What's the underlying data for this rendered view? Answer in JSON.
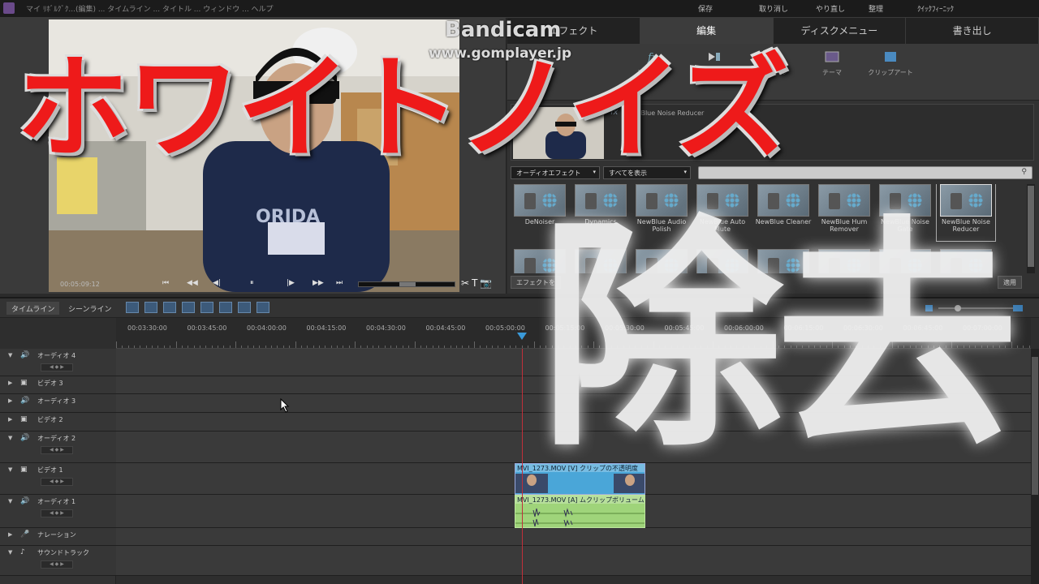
{
  "window": {
    "title": "マイ ﾘﾎﾞﾙｸﾞｸ...(編集) ... タイムライン ... タイトル ... ウィンドウ ... ヘルプ",
    "menu_right": [
      "保存",
      "取り消し",
      "やり直し",
      "整理",
      "ｸｲｯｸﾌｨｰﾆｯｸ"
    ]
  },
  "watermark": {
    "brand": "Bandicam",
    "url": "www.gomplayer.jp"
  },
  "overlay_text": {
    "red_caption": "ホワイトノイズ",
    "white_caption": "除去"
  },
  "monitor": {
    "timecode": "00:05:09:12",
    "transport": [
      "⏮",
      "◀◀",
      "◀|",
      "⏸",
      "|▶",
      "▶▶",
      "⏭"
    ],
    "tools": [
      "✂",
      "T",
      "📷"
    ]
  },
  "tabs": [
    "エフェクト",
    "編集",
    "ディスクメニュー",
    "書き出し"
  ],
  "active_tab": "編集",
  "toolbar": [
    {
      "label": "エフェクト",
      "icon": "fx-icon"
    },
    {
      "label": "トランジション",
      "icon": "transition-icon"
    },
    {
      "label": "タイトル",
      "icon": "title-icon"
    },
    {
      "label": "テーマ",
      "icon": "theme-icon"
    },
    {
      "label": "クリップアート",
      "icon": "clipart-icon"
    }
  ],
  "fx_panel": {
    "effect_name": "NewBlue Noise Reducer",
    "fx_mark": "fx"
  },
  "filters": {
    "category": "オーディオエフェクト",
    "view": "すべてを表示",
    "search_value": ""
  },
  "effects": [
    {
      "label": "DeNoiser"
    },
    {
      "label": "Dynamics"
    },
    {
      "label": "NewBlue Audio Polish"
    },
    {
      "label": "NewBlue Auto Mute"
    },
    {
      "label": "NewBlue Cleaner"
    },
    {
      "label": "NewBlue Hum Remover"
    },
    {
      "label": "NewBlue Noise Gate"
    },
    {
      "label": "NewBlue Noise Reducer"
    }
  ],
  "selected_effect_index": 7,
  "apply_bar": {
    "left_button": "エフェクトを",
    "apply_button": "適用"
  },
  "timeline": {
    "views": [
      "タイムライン",
      "シーンライン"
    ],
    "active_view": "タイムライン",
    "ruler": [
      "00:03:30:00",
      "00:03:45:00",
      "00:04:00:00",
      "00:04:15:00",
      "00:04:30:00",
      "00:04:45:00",
      "00:05:00:00",
      "00:05:15:00",
      "00:05:30:00",
      "00:05:45:00",
      "00:06:00:00",
      "00:06:15:00",
      "00:06:30:00",
      "00:06:45:00",
      "00:07:00:00"
    ],
    "tracks": [
      {
        "name": "オーディオ 4",
        "type": "audio",
        "h": 34
      },
      {
        "name": "ビデオ 3",
        "type": "video",
        "h": 22
      },
      {
        "name": "オーディオ 3",
        "type": "audio",
        "h": 23
      },
      {
        "name": "ビデオ 2",
        "type": "video",
        "h": 23
      },
      {
        "name": "オーディオ 2",
        "type": "audio",
        "h": 39
      },
      {
        "name": "ビデオ 1",
        "type": "video",
        "h": 39
      },
      {
        "name": "オーディオ 1",
        "type": "audio",
        "h": 41
      },
      {
        "name": "ナレーション",
        "type": "narration",
        "h": 22
      },
      {
        "name": "サウンドトラック",
        "type": "soundtrack",
        "h": 37
      }
    ],
    "video_clip": "MVI_1273.MOV [V] クリップの不透明度",
    "audio_clip": "MVI_1273.MOV [A] ムクリップボリューム"
  }
}
